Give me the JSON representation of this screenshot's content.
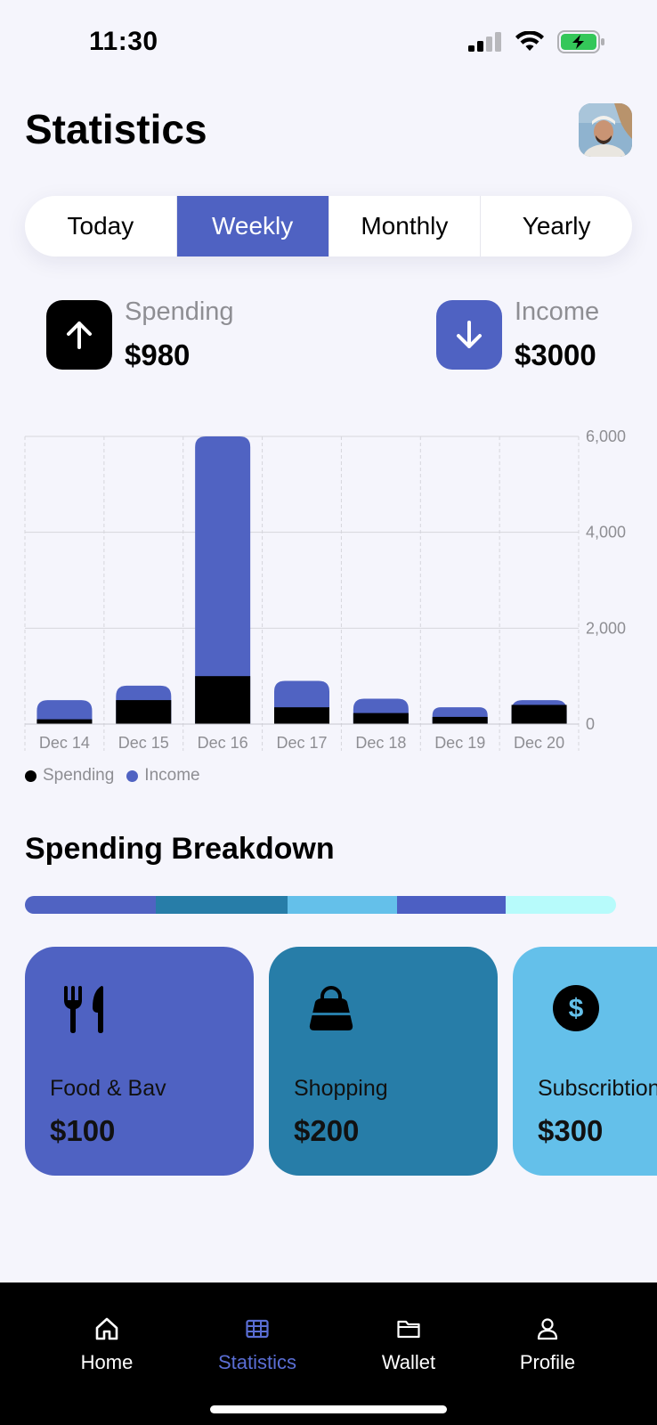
{
  "status_bar": {
    "time": "11:30"
  },
  "header": {
    "title": "Statistics"
  },
  "segmented": {
    "options": [
      "Today",
      "Weekly",
      "Monthly",
      "Yearly"
    ],
    "selected": "Weekly"
  },
  "summary": {
    "spending": {
      "label": "Spending",
      "value": "$980",
      "icon": "arrow-up-icon"
    },
    "income": {
      "label": "Income",
      "value": "$3000",
      "icon": "arrow-down-icon"
    }
  },
  "colors": {
    "accent": "#4F62C2",
    "spending": "#000000",
    "income": "#5063C2",
    "background": "#F5F5FC"
  },
  "chart_data": {
    "type": "bar",
    "stacked": true,
    "categories": [
      "Dec 14",
      "Dec 15",
      "Dec 16",
      "Dec 17",
      "Dec 18",
      "Dec 19",
      "Dec 20"
    ],
    "series": [
      {
        "name": "Spending",
        "color": "#000000",
        "values": [
          100,
          500,
          1000,
          350,
          230,
          150,
          400
        ]
      },
      {
        "name": "Income",
        "color": "#5063C2",
        "values": [
          400,
          300,
          5000,
          550,
          300,
          200,
          100
        ]
      }
    ],
    "yticks": [
      "6,000",
      "4,000",
      "2,000",
      "0"
    ],
    "ylim": [
      0,
      6000
    ],
    "grid": true,
    "legend_position": "bottom-left"
  },
  "breakdown": {
    "title": "Spending Breakdown",
    "segments": [
      {
        "color": "#5063C2",
        "fraction": 0.222
      },
      {
        "color": "#277DA8",
        "fraction": 0.222
      },
      {
        "color": "#64C0EA",
        "fraction": 0.185
      },
      {
        "color": "#4C5FC3",
        "fraction": 0.185
      },
      {
        "color": "#B7FBFB",
        "fraction": 0.186
      }
    ],
    "cards": [
      {
        "label": "Food & Bav",
        "value": "$100",
        "color": "#4F62C2",
        "icon": "fork-knife-icon"
      },
      {
        "label": "Shopping",
        "value": "$200",
        "color": "#277DA8",
        "icon": "shopping-bag-icon"
      },
      {
        "label": "Subscribtion",
        "value": "$300",
        "color": "#64C0EA",
        "icon": "dollar-icon"
      }
    ]
  },
  "tabbar": {
    "items": [
      {
        "label": "Home",
        "icon": "home-icon"
      },
      {
        "label": "Statistics",
        "icon": "table-icon"
      },
      {
        "label": "Wallet",
        "icon": "folder-icon"
      },
      {
        "label": "Profile",
        "icon": "person-icon"
      }
    ],
    "active": "Statistics"
  }
}
